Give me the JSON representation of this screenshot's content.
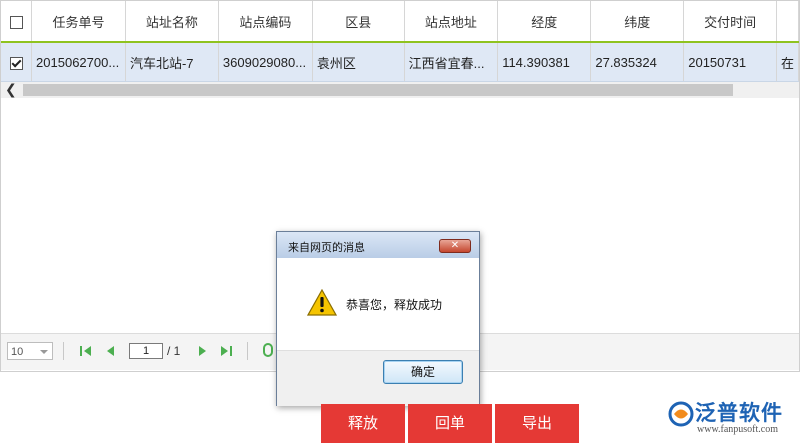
{
  "grid": {
    "columns": [
      "任务单号",
      "站址名称",
      "站点编码",
      "区县",
      "站点地址",
      "经度",
      "纬度",
      "交付时间",
      ""
    ],
    "rows": [
      {
        "selected": true,
        "cells": [
          "2015062700...",
          "汽车北站-7",
          "3609029080...",
          "袁州区",
          "江西省宜春...",
          "114.390381",
          "27.835324",
          "20150731",
          "在"
        ]
      }
    ]
  },
  "pager": {
    "page_size": "10",
    "page_input": "1",
    "page_total": "/ 1"
  },
  "dialog": {
    "title": "来自网页的消息",
    "message": "恭喜您，释放成功",
    "ok_label": "确定",
    "icon": "warning-icon"
  },
  "actions": {
    "release_label": "释放",
    "reply_label": "回单",
    "export_label": "导出"
  },
  "logo": {
    "brand": "泛普软件",
    "url": "www.fanpusoft.com"
  },
  "colors": {
    "header_underline": "#8fc31f",
    "selected_row": "#dfe8f5",
    "action_button": "#e53935",
    "brand_blue": "#1e63b4",
    "pager_green": "#4caf50"
  }
}
